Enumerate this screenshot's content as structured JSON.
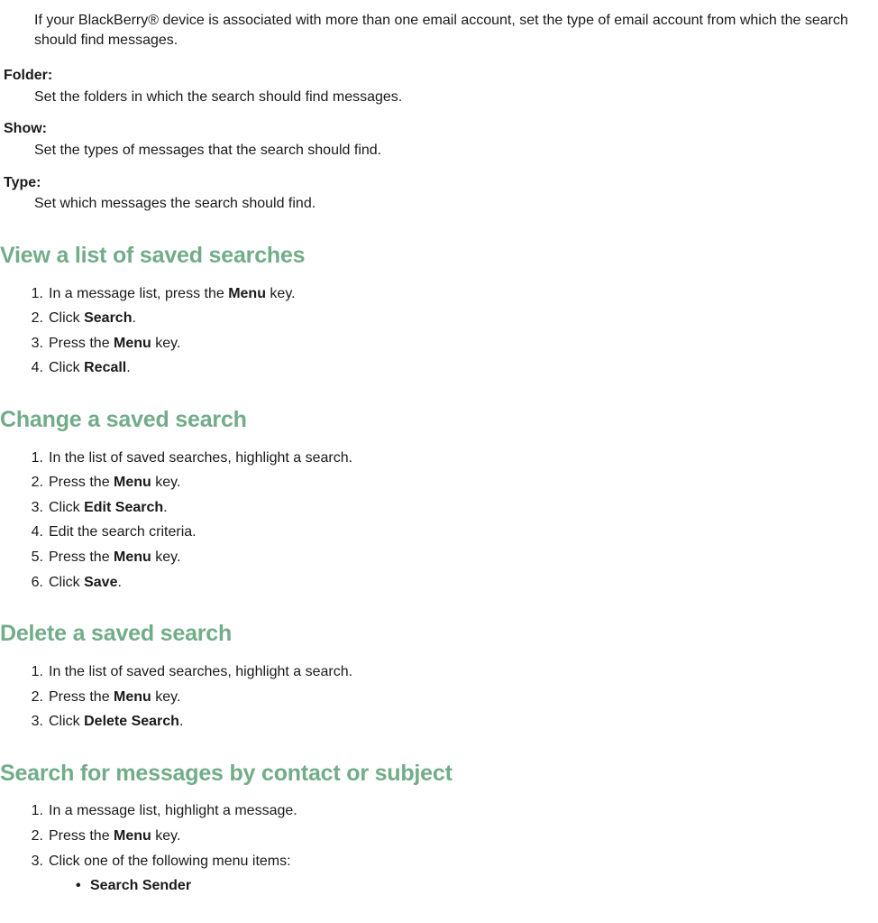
{
  "intro": {
    "text": "If your BlackBerry® device is associated with more than one email account, set the type of email account from which the search should find messages."
  },
  "criteria": [
    {
      "label": "Folder:",
      "desc": "Set the folders in which the search should find messages."
    },
    {
      "label": "Show:",
      "desc": "Set the types of messages that the search should find."
    },
    {
      "label": "Type:",
      "desc": "Set which messages the search should find."
    }
  ],
  "sections": {
    "view": {
      "heading": "View a list of saved searches",
      "steps": [
        {
          "pre": "In a message list, press the ",
          "b": "Menu",
          "post": " key."
        },
        {
          "pre": "Click ",
          "b": "Search",
          "post": "."
        },
        {
          "pre": "Press the ",
          "b": "Menu",
          "post": " key."
        },
        {
          "pre": "Click ",
          "b": "Recall",
          "post": "."
        }
      ]
    },
    "change": {
      "heading": "Change a saved search",
      "steps": [
        {
          "pre": "In the list of saved searches, highlight a search.",
          "b": "",
          "post": ""
        },
        {
          "pre": "Press the ",
          "b": "Menu",
          "post": " key."
        },
        {
          "pre": "Click ",
          "b": "Edit Search",
          "post": "."
        },
        {
          "pre": "Edit the search criteria.",
          "b": "",
          "post": ""
        },
        {
          "pre": "Press the ",
          "b": "Menu",
          "post": " key."
        },
        {
          "pre": "Click ",
          "b": "Save",
          "post": "."
        }
      ]
    },
    "delete": {
      "heading": "Delete a saved search",
      "steps": [
        {
          "pre": "In the list of saved searches, highlight a search.",
          "b": "",
          "post": ""
        },
        {
          "pre": "Press the ",
          "b": "Menu",
          "post": " key."
        },
        {
          "pre": "Click ",
          "b": "Delete Search",
          "post": "."
        }
      ]
    },
    "searchby": {
      "heading": "Search for messages by contact or subject",
      "steps": [
        {
          "pre": "In a message list, highlight a message.",
          "b": "",
          "post": ""
        },
        {
          "pre": "Press the ",
          "b": "Menu",
          "post": " key."
        },
        {
          "pre": "Click one of the following menu items:",
          "b": "",
          "post": ""
        }
      ],
      "menuItems": [
        {
          "b": "Search Sender"
        }
      ]
    }
  }
}
